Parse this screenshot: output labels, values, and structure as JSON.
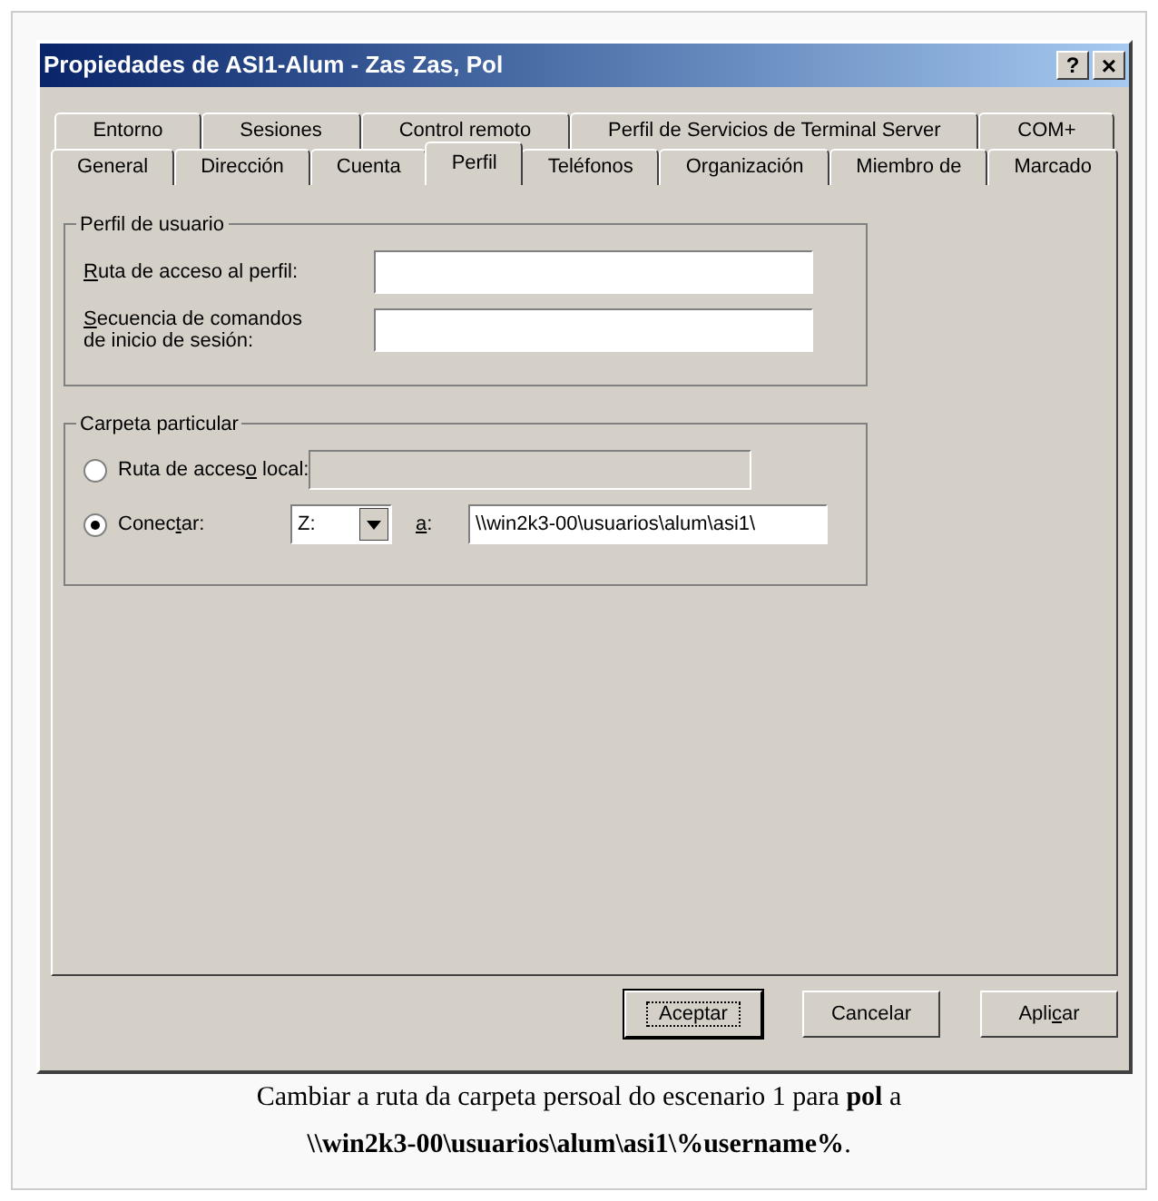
{
  "window": {
    "title": "Propiedades de ASI1-Alum - Zas Zas, Pol",
    "help_button": "?",
    "close_button": "×"
  },
  "tabs_back": [
    {
      "label": "Entorno",
      "selected": false
    },
    {
      "label": "Sesiones",
      "selected": false
    },
    {
      "label": "Control remoto",
      "selected": false
    },
    {
      "label": "Perfil de Servicios de Terminal Server",
      "selected": false
    },
    {
      "label": "COM+",
      "selected": false
    }
  ],
  "tabs_front": [
    {
      "label": "General",
      "selected": false
    },
    {
      "label": "Dirección",
      "selected": false
    },
    {
      "label": "Cuenta",
      "selected": false
    },
    {
      "label": "Perfil",
      "selected": true
    },
    {
      "label": "Teléfonos",
      "selected": false
    },
    {
      "label": "Organización",
      "selected": false
    },
    {
      "label": "Miembro de",
      "selected": false
    },
    {
      "label": "Marcado",
      "selected": false
    }
  ],
  "user_profile": {
    "title": "Perfil de usuario",
    "fields": [
      {
        "label": {
          "key": "R",
          "after": "uta de acceso al perfil:"
        }
      },
      {
        "label": {
          "key": "S",
          "after": "ecuencia de comandos\nde inicio de sesión:"
        }
      }
    ]
  },
  "home_folder": {
    "title": "Carpeta particular",
    "local": {
      "selected": false,
      "label": {
        "before": "Ruta de acces",
        "key": "o",
        "after": " local:"
      },
      "disabled": true
    },
    "connect": {
      "selected": true,
      "label": {
        "before": "Conec",
        "key": "t",
        "after": "ar:"
      },
      "drive": "Z:",
      "to_label": {
        "key": "a",
        "after": ":"
      },
      "path": "\\\\win2k3-00\\usuarios\\alum\\asi1\\"
    }
  },
  "buttons": [
    {
      "label": {
        "before": "Aceptar"
      },
      "default": true
    },
    {
      "label": {
        "before": "Cancelar"
      },
      "default": false
    },
    {
      "label": {
        "before": "Apli",
        "key": "c",
        "after": "ar"
      },
      "default": false
    }
  ],
  "caption": "Cambiar a ruta da carpeta persoal do escenario 1 para **pol** a **\\\\win2k3-00\\usuarios\\alum\\asi1\\%username%**."
}
